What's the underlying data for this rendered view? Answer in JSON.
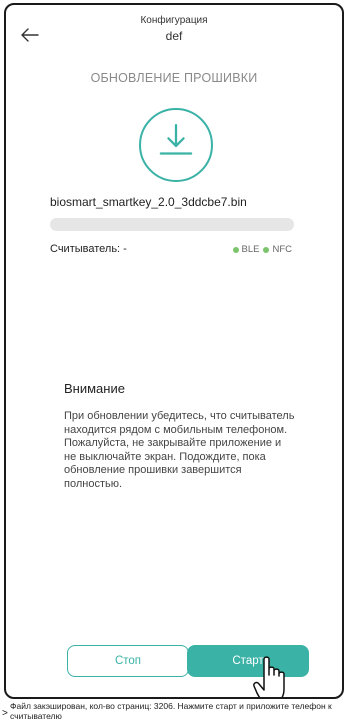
{
  "header": {
    "title": "Конфигурация",
    "subtitle": "def"
  },
  "section_title": "ОБНОВЛЕНИЕ ПРОШИВКИ",
  "firmware": {
    "filename": "biosmart_smartkey_2.0_3ddcbe7.bin",
    "progress_percent": 0
  },
  "reader": {
    "label": "Считыватель: -",
    "protocols": [
      "BLE",
      "NFC"
    ],
    "status_color": "#7cc46b"
  },
  "attention": {
    "title": "Внимание",
    "text": "При обновлении убедитесь, что считыватель находится рядом с мобильным телефоном. Пожалуйста, не закрывайте приложение и не выключайте экран. Подождите, пока обновление прошивки завершится полностью."
  },
  "buttons": {
    "stop_label": "Стоп",
    "start_label": "Старт"
  },
  "status_bar": {
    "caret": ">",
    "text": "Файл закэширован, кол-во страниц: 3206. Нажмите старт и приложите телефон к считывателю"
  },
  "colors": {
    "accent": "#3ab2a6"
  },
  "icons": {
    "back": "arrow-left-icon",
    "download": "download-icon",
    "cursor": "hand-pointer-icon"
  }
}
